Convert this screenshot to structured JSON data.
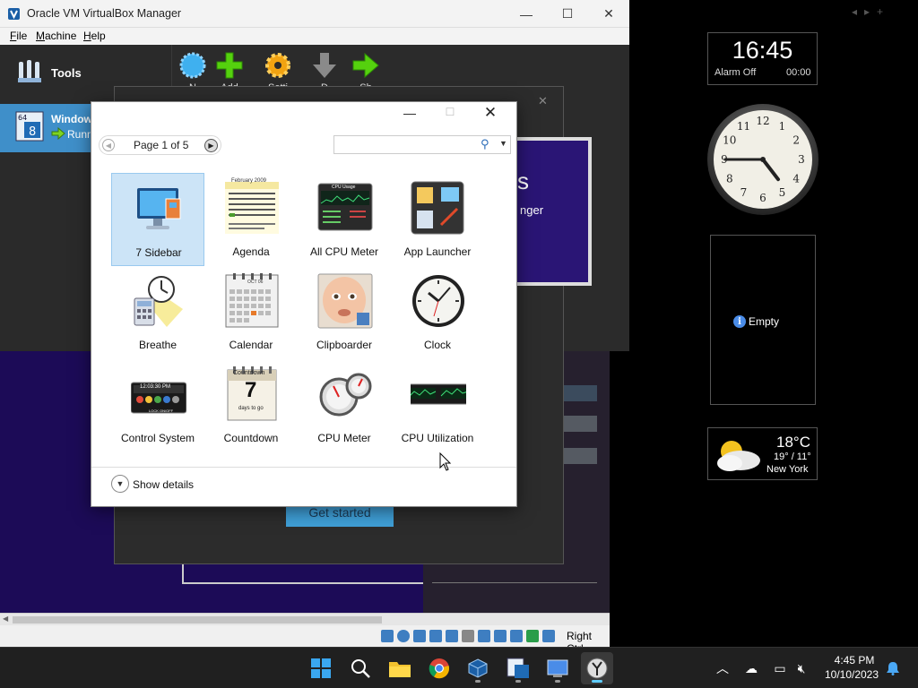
{
  "vbox": {
    "title": "Oracle VM VirtualBox Manager",
    "menu": [
      "File",
      "Machine",
      "Help"
    ],
    "tools_label": "Tools",
    "vm_name": "Window",
    "vm_state": "Runn",
    "toolbar_labels": [
      "N",
      "Add",
      "Setti",
      "D",
      "Sh"
    ],
    "right_ctrl": "Right Ctrl",
    "back_text_s": "s",
    "back_text_nger": "nger",
    "get_started": "Get started",
    "win_min": "—",
    "win_max": "☐",
    "win_close": "✕"
  },
  "gallery": {
    "page_label": "Page 1 of 5",
    "search_placeholder": "",
    "show_details": "Show details",
    "gadgets": [
      {
        "label": "7 Sidebar",
        "selected": true
      },
      {
        "label": "Agenda"
      },
      {
        "label": "All CPU Meter"
      },
      {
        "label": "App Launcher"
      },
      {
        "label": "Breathe"
      },
      {
        "label": "Calendar"
      },
      {
        "label": "Clipboarder"
      },
      {
        "label": "Clock"
      },
      {
        "label": "Control System"
      },
      {
        "label": "Countdown"
      },
      {
        "label": "CPU Meter"
      },
      {
        "label": "CPU Utilization"
      }
    ],
    "agenda_header": "February 2009",
    "calendar_month": "OCT 06",
    "control_time": "12:03:30 PM",
    "control_lock": "LOCK ON/OFF",
    "countdown_title": "Countdown",
    "countdown_value": "7",
    "countdown_sub": "days to go",
    "cpu_usage_title": "CPU Usage"
  },
  "sidebar": {
    "time": "16:45",
    "alarm_label": "Alarm Off",
    "alarm_time": "00:00",
    "clock": {
      "hour": 4,
      "minute": 45
    },
    "empty_label": "Empty",
    "weather_temp": "18°C",
    "weather_range": "19° / 11°",
    "weather_city": "New York"
  },
  "taskbar": {
    "time": "4:45 PM",
    "date": "10/10/2023"
  },
  "colors": {
    "accent": "#60cdff",
    "vm_selected": "#3f8fc9",
    "vm_background": "#1c0b57"
  }
}
